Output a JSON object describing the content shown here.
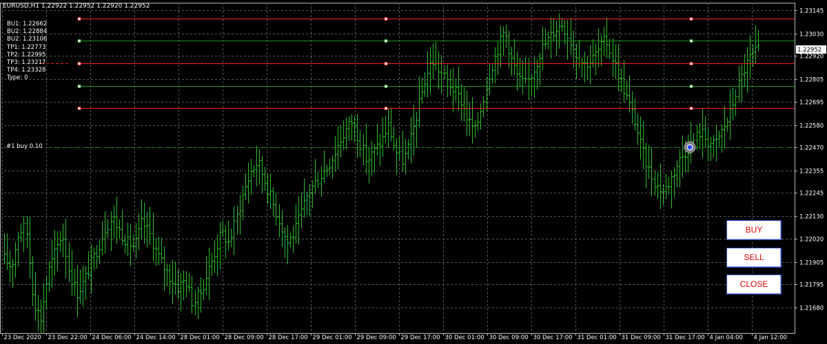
{
  "chart": {
    "title": "EURUSD,H1  1.22922 1.22952 1.22920 1.22952",
    "current_price": "1.22952",
    "colors": {
      "background": "#000000",
      "grid": "#5a5a5a",
      "bars": "#2dbf2d",
      "red_line": "#ff2020",
      "green_line": "#1e9a1e",
      "order_line": "#1f7f1f"
    }
  },
  "ea_panel": {
    "lines": [
      "BU1: 1.22662",
      "BU2: 1.22884",
      "BU2: 1.23106",
      "TP1: 1.22773",
      "TP2: 1.22995",
      "TP3: 1.23217",
      "TP4: 1.23328",
      "Type: 0"
    ]
  },
  "order": {
    "label": "#1 buy 0.10"
  },
  "buttons": {
    "buy": "BUY",
    "sell": "SELL",
    "close": "CLOSE"
  },
  "chart_data": {
    "type": "ohlc",
    "symbol": "EURUSD",
    "timeframe": "H1",
    "ylim": [
      1.21623,
      1.23199
    ],
    "y_ticks": [
      "1.23145",
      "1.23030",
      "1.22920",
      "1.22805",
      "1.22695",
      "1.22580",
      "1.22470",
      "1.22355",
      "1.22245",
      "1.22130",
      "1.22020",
      "1.21905",
      "1.21795",
      "1.21680"
    ],
    "x_ticks": [
      "23 Dec 2020",
      "23 Dec 22:00",
      "24 Dec 06:00",
      "24 Dec 14:00",
      "28 Dec 01:00",
      "28 Dec 09:00",
      "28 Dec 17:00",
      "29 Dec 01:00",
      "29 Dec 09:00",
      "29 Dec 17:00",
      "30 Dec 01:00",
      "30 Dec 09:00",
      "30 Dec 17:00",
      "31 Dec 01:00",
      "31 Dec 09:00",
      "31 Dec 17:00",
      "4 Jan 04:00",
      "4 Jan 12:00"
    ],
    "horizontal_levels": [
      {
        "price": 1.23106,
        "style": "red"
      },
      {
        "price": 1.22995,
        "style": "green"
      },
      {
        "price": 1.22884,
        "style": "red"
      },
      {
        "price": 1.22773,
        "style": "green"
      },
      {
        "price": 1.22662,
        "style": "red"
      },
      {
        "price": 1.2247,
        "style": "order"
      }
    ],
    "close_path": [
      1.2192,
      1.2188,
      1.2205,
      1.2208,
      1.2172,
      1.2162,
      1.2185,
      1.2195,
      1.2205,
      1.2185,
      1.2175,
      1.2181,
      1.219,
      1.2198,
      1.2208,
      1.2212,
      1.2205,
      1.22,
      1.2198,
      1.221,
      1.2205,
      1.2195,
      1.2188,
      1.2182,
      1.2178,
      1.2182,
      1.217,
      1.2175,
      1.2185,
      1.2195,
      1.2205,
      1.22,
      1.2212,
      1.2225,
      1.2235,
      1.224,
      1.223,
      1.222,
      1.221,
      1.22,
      1.2205,
      1.2215,
      1.2225,
      1.223,
      1.2235,
      1.224,
      1.2248,
      1.2255,
      1.226,
      1.225,
      1.224,
      1.2245,
      1.225,
      1.2258,
      1.2245,
      1.224,
      1.225,
      1.2265,
      1.228,
      1.229,
      1.2285,
      1.228,
      1.2275,
      1.227,
      1.226,
      1.2255,
      1.227,
      1.2285,
      1.2295,
      1.2305,
      1.229,
      1.228,
      1.2278,
      1.2285,
      1.2295,
      1.23,
      1.2305,
      1.2308,
      1.23,
      1.2292,
      1.2288,
      1.229,
      1.2295,
      1.23,
      1.229,
      1.228,
      1.227,
      1.226,
      1.2245,
      1.2235,
      1.2228,
      1.2225,
      1.2232,
      1.224,
      1.2245,
      1.225,
      1.2255,
      1.225,
      1.2248,
      1.2255,
      1.2262,
      1.2275,
      1.2285,
      1.2292,
      1.2295
    ]
  }
}
